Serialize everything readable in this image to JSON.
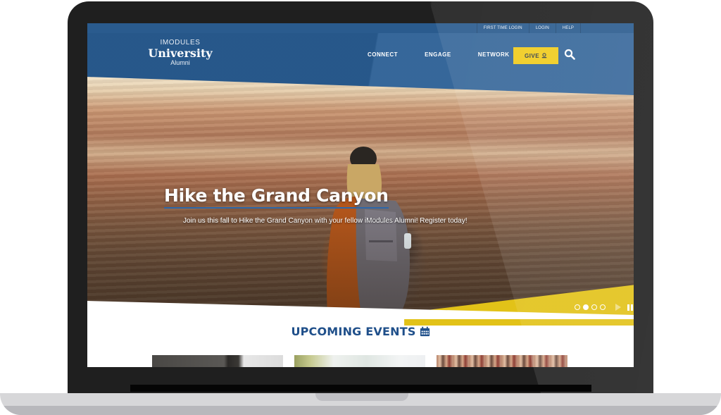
{
  "utility_nav": [
    "FIRST TIME LOGIN",
    "LOGIN",
    "HELP"
  ],
  "logo": {
    "top": "IMODULES",
    "main": "University",
    "sub": "Alumni"
  },
  "main_nav": [
    "CONNECT",
    "ENGAGE",
    "NETWORK"
  ],
  "give_button": {
    "label": "GIVE",
    "icon": "donate-icon"
  },
  "search": {
    "icon": "search-icon"
  },
  "hero": {
    "title": "Hike the Grand Canyon",
    "subtitle": "Join us this fall to Hike the Grand Canyon with your fellow iModules Alumni! Register today!",
    "slides_total": 4,
    "active_slide": 2
  },
  "events": {
    "heading": "UPCOMING EVENTS",
    "icon": "calendar-icon",
    "cards": [
      "event-card-1",
      "event-card-2",
      "event-card-3"
    ]
  },
  "colors": {
    "brand_blue": "#2a5e94",
    "accent_yellow": "#f0cb1d",
    "heading_blue": "#1f4f8a"
  }
}
